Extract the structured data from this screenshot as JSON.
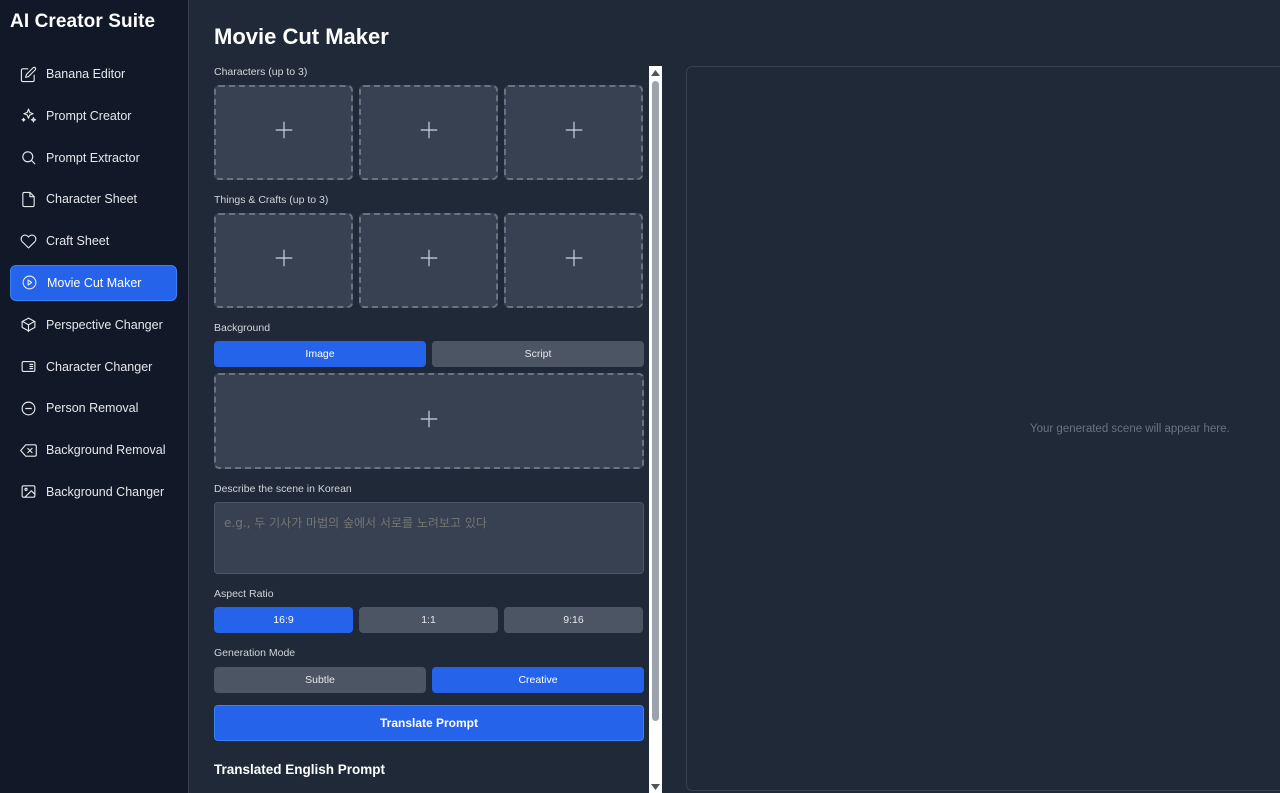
{
  "app": {
    "title": "AI Creator Suite"
  },
  "sidebar": {
    "items": [
      {
        "label": "Banana Editor",
        "icon": "edit-icon"
      },
      {
        "label": "Prompt Creator",
        "icon": "sparkles-icon"
      },
      {
        "label": "Prompt Extractor",
        "icon": "search-icon"
      },
      {
        "label": "Character Sheet",
        "icon": "file-icon"
      },
      {
        "label": "Craft Sheet",
        "icon": "heart-icon"
      },
      {
        "label": "Movie Cut Maker",
        "icon": "play-circle-icon",
        "active": true
      },
      {
        "label": "Perspective Changer",
        "icon": "cube-icon"
      },
      {
        "label": "Character Changer",
        "icon": "swap-card-icon"
      },
      {
        "label": "Person Removal",
        "icon": "minus-circle-icon"
      },
      {
        "label": "Background Removal",
        "icon": "eraser-icon"
      },
      {
        "label": "Background Changer",
        "icon": "image-icon"
      }
    ]
  },
  "main": {
    "title": "Movie Cut Maker",
    "characters_label": "Characters (up to 3)",
    "things_label": "Things & Crafts (up to 3)",
    "background_label": "Background",
    "background_tabs": [
      "Image",
      "Script"
    ],
    "background_active": "Image",
    "describe_label": "Describe the scene in Korean",
    "describe_placeholder": "e.g., 두 기사가 마법의 숲에서 서로를 노려보고 있다",
    "aspect_label": "Aspect Ratio",
    "aspect_options": [
      "16:9",
      "1:1",
      "9:16"
    ],
    "aspect_active": "16:9",
    "mode_label": "Generation Mode",
    "mode_options": [
      "Subtle",
      "Creative"
    ],
    "mode_active": "Creative",
    "translate_button": "Translate Prompt",
    "translated_heading": "Translated English Prompt"
  },
  "result": {
    "placeholder": "Your generated scene will appear here."
  },
  "colors": {
    "accent": "#2563eb",
    "sidebar_bg": "#111827",
    "main_bg": "#1f2937",
    "panel_bg": "#374151"
  }
}
